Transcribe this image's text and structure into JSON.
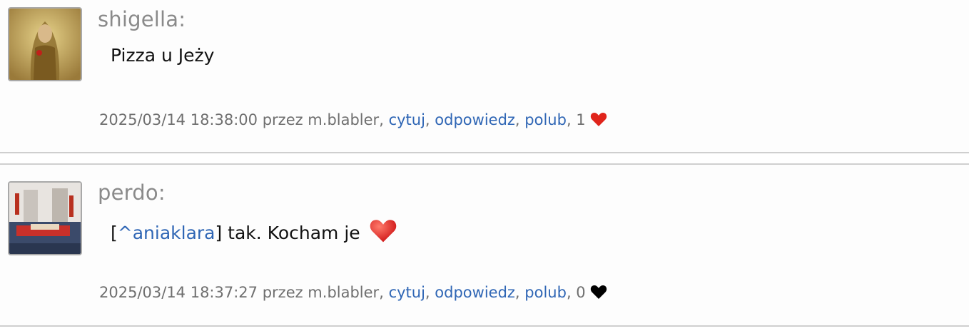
{
  "posts": [
    {
      "author": "shigella:",
      "content": "Pizza u Jeży",
      "meta": {
        "datetime_by": "2025/03/14 18:38:00 przez m.blabler",
        "cytuj": "cytuj",
        "odpowiedz": "odpowiedz",
        "polub": "polub",
        "likes": "1",
        "heart_color": "#e0241b"
      }
    },
    {
      "author": "perdo:",
      "content": {
        "open_bracket": "[",
        "mention": "^aniaklara",
        "close_rest": "] tak. Kocham je"
      },
      "meta": {
        "datetime_by": "2025/03/14 18:37:27 przez m.blabler",
        "cytuj": "cytuj",
        "odpowiedz": "odpowiedz",
        "polub": "polub",
        "likes": "0",
        "heart_color": "#000000"
      }
    }
  ],
  "icons": {
    "post1_avatar": "painting-avatar",
    "post2_avatar": "photo-avatar",
    "inline_emoji": "red-heart-emoji",
    "like_heart": "heart-icon"
  }
}
